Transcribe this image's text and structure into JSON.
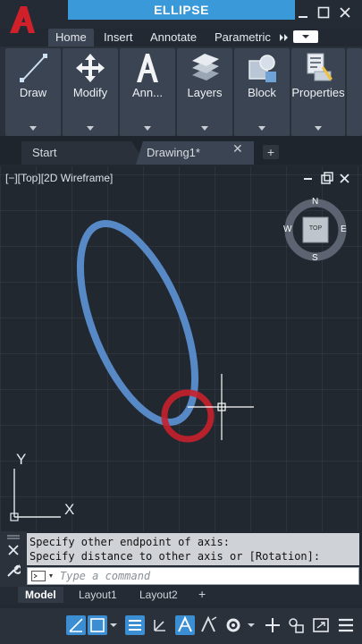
{
  "window": {
    "title": "ELLIPSE",
    "app_icon": "autocad-logo-icon"
  },
  "ribbon_tabs": [
    {
      "label": "Home"
    },
    {
      "label": "Insert"
    },
    {
      "label": "Annotate"
    },
    {
      "label": "Parametric"
    }
  ],
  "ribbon_panels": [
    {
      "label": "Draw",
      "icon": "line-icon"
    },
    {
      "label": "Modify",
      "icon": "move-icon"
    },
    {
      "label": "Ann...",
      "icon": "text-icon"
    },
    {
      "label": "Layers",
      "icon": "layers-icon"
    },
    {
      "label": "Block",
      "icon": "block-icon"
    },
    {
      "label": "Properties",
      "icon": "properties-icon"
    }
  ],
  "file_tabs": [
    {
      "label": "Start"
    },
    {
      "label": "Drawing1*"
    }
  ],
  "viewport": {
    "label": "[−][Top][2D Wireframe]",
    "viewcube": {
      "top": "TOP",
      "n": "N",
      "s": "S",
      "e": "E",
      "w": "W"
    },
    "ucs": {
      "x": "X",
      "y": "Y"
    }
  },
  "command": {
    "history": [
      "Specify other endpoint of axis:",
      "Specify distance to other axis or [Rotation]:"
    ],
    "placeholder": "Type a command"
  },
  "layout_tabs": [
    {
      "label": "Model"
    },
    {
      "label": "Layout1"
    },
    {
      "label": "Layout2"
    }
  ],
  "colors": {
    "accent": "#3a9ad9",
    "ellipse": "#5b8ecf",
    "highlight_ring": "#c8202c"
  }
}
